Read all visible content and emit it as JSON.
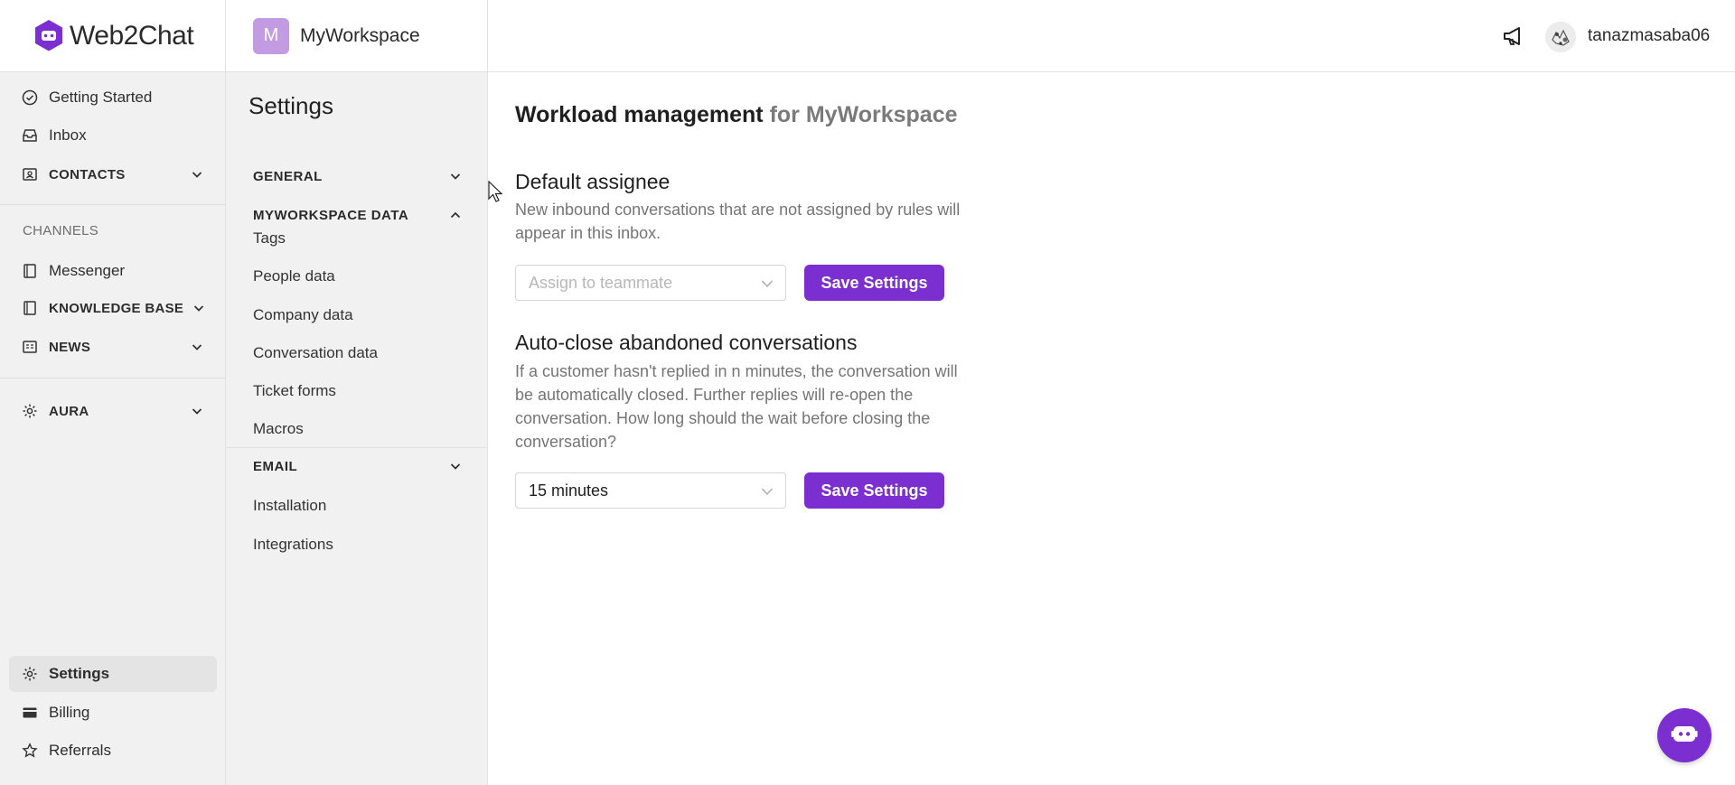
{
  "brand": {
    "name": "Web2Chat"
  },
  "workspace": {
    "avatar_letter": "M",
    "name": "MyWorkspace"
  },
  "leftnav": {
    "getting_started": "Getting Started",
    "inbox": "Inbox",
    "contacts": "CONTACTS",
    "channels_header": "CHANNELS",
    "messenger": "Messenger",
    "knowledge_base": "KNOWLEDGE BASE",
    "news": "NEWS",
    "aura": "AURA",
    "settings": "Settings",
    "billing": "Billing",
    "referrals": "Referrals"
  },
  "settings_panel": {
    "title": "Settings",
    "general": "GENERAL",
    "workspace_data": "MYWORKSPACE DATA",
    "items": [
      "Tags",
      "People data",
      "Company data",
      "Conversation data",
      "Ticket forms",
      "Macros"
    ],
    "email": "EMAIL",
    "installation": "Installation",
    "integrations": "Integrations"
  },
  "topbar": {
    "username": "tanazmasaba06"
  },
  "main": {
    "title": "Workload management",
    "title_suffix": "for MyWorkspace",
    "default_assignee": {
      "title": "Default assignee",
      "description": "New inbound conversations that are not assigned by rules will appear in this inbox.",
      "select_placeholder": "Assign to teammate",
      "save_label": "Save Settings"
    },
    "auto_close": {
      "title": "Auto-close abandoned conversations",
      "description": "If a customer hasn't replied in n minutes, the conversation will be automatically closed. Further replies will re-open the conversation. How long should the wait before closing the conversation?",
      "select_value": "15 minutes",
      "save_label": "Save Settings"
    }
  },
  "colors": {
    "accent": "#7b2fd0",
    "workspace_avatar": "#c39be3",
    "nav_bg": "#f1f1f1"
  }
}
